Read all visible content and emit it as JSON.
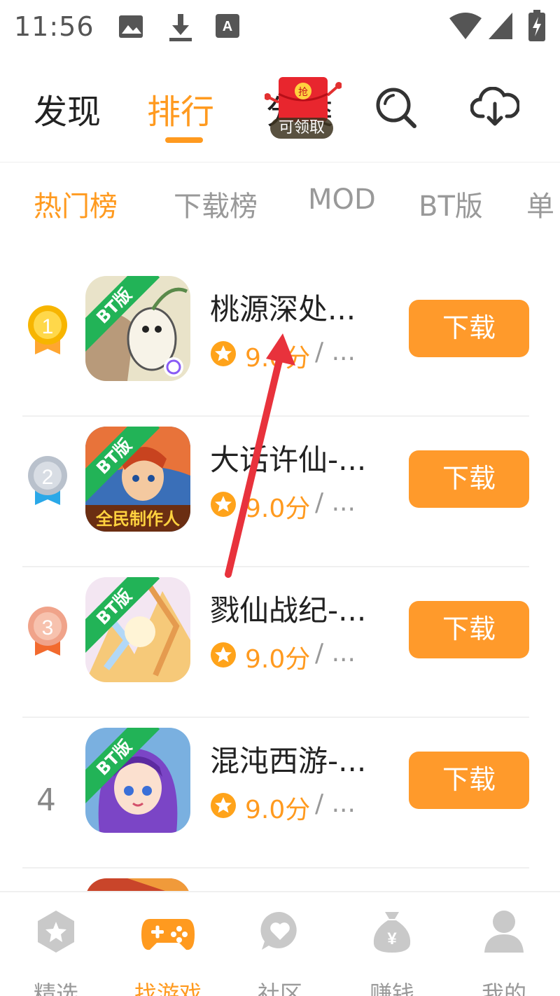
{
  "status_bar": {
    "time": "11:56",
    "icons": [
      "image-icon",
      "download-icon",
      "keyboard-a-icon",
      "wifi-icon",
      "signal-icon",
      "battery-charging-icon"
    ]
  },
  "top_nav": {
    "tabs": [
      {
        "label": "发现",
        "active": false
      },
      {
        "label": "排行",
        "active": true
      },
      {
        "label": "分类",
        "active": false
      }
    ],
    "redpack": {
      "badge": "抢",
      "label": "可领取"
    },
    "icons": [
      "search-icon",
      "cloud-download-icon"
    ]
  },
  "category_tabs": [
    {
      "label": "热门榜",
      "active": true
    },
    {
      "label": "下载榜",
      "active": false
    },
    {
      "label": "MOD",
      "active": false
    },
    {
      "label": "BT版",
      "active": false
    },
    {
      "label": "单",
      "active": false
    }
  ],
  "games": [
    {
      "rank": "1",
      "medal": "gold",
      "name": "桃源深处...",
      "badge": "BT版",
      "score": "9.0分",
      "sep": "/ ...",
      "button": "下载"
    },
    {
      "rank": "2",
      "medal": "silver",
      "name": "大话许仙-...",
      "badge": "BT版",
      "score": "9.0分",
      "sep": "/ ...",
      "button": "下载"
    },
    {
      "rank": "3",
      "medal": "bronze",
      "name": "戮仙战纪-...",
      "badge": "BT版",
      "score": "9.0分",
      "sep": "/ ...",
      "button": "下载"
    },
    {
      "rank": "4",
      "medal": "none",
      "name": "混沌西游-...",
      "badge": "BT版",
      "score": "9.0分",
      "sep": "/ ...",
      "button": "下载"
    }
  ],
  "bottom_nav": [
    {
      "label": "精选",
      "icon": "star-hexagon-icon",
      "active": false
    },
    {
      "label": "找游戏",
      "icon": "gamepad-icon",
      "active": true
    },
    {
      "label": "社区",
      "icon": "chat-heart-icon",
      "active": false
    },
    {
      "label": "赚钱",
      "icon": "money-bag-icon",
      "active": false
    },
    {
      "label": "我的",
      "icon": "user-icon",
      "active": false
    }
  ],
  "colors": {
    "accent": "#ff9a1f",
    "button": "#ff9a2b",
    "bt_badge": "#22b357",
    "annotation_arrow": "#e8323c"
  }
}
